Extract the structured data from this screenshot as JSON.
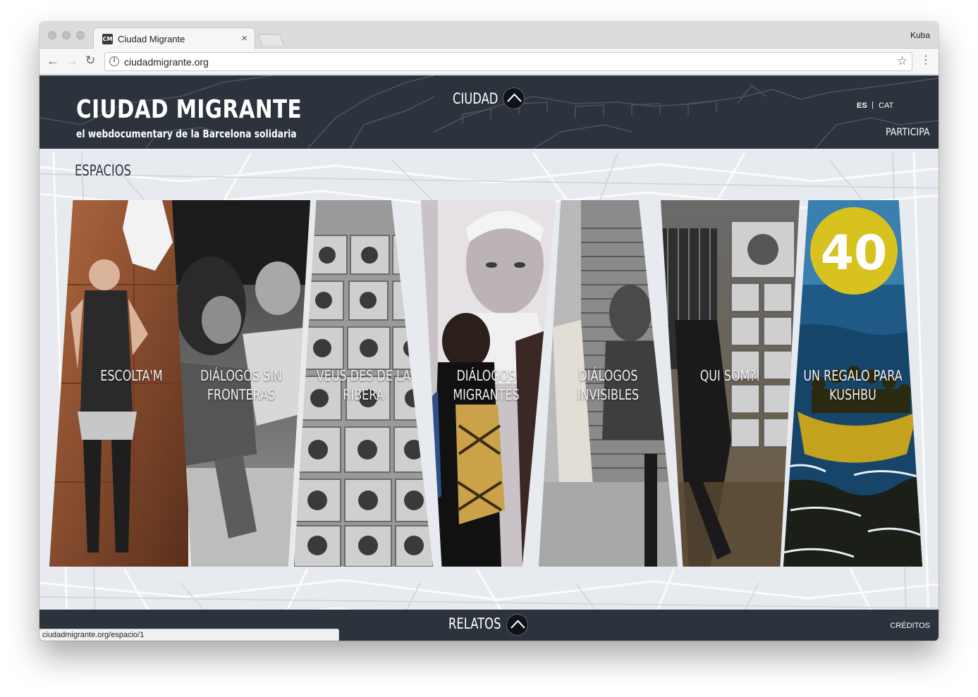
{
  "browser": {
    "tab_title": "Ciudad Migrante",
    "tab_favicon": "CM",
    "profile_name": "Kuba",
    "url": "ciudadmigrante.org",
    "status_url": "ciudadmigrante.org/espacio/1"
  },
  "header": {
    "title": "CIUDAD MIGRANTE",
    "subtitle": "el webdocumentary de la Barcelona solidaria",
    "nav_label": "CIUDAD",
    "lang_es": "ES",
    "lang_separator": "|",
    "lang_cat": "CAT",
    "participa": "PARTICIPA"
  },
  "section": {
    "title": "ESPACIOS"
  },
  "panels": [
    {
      "label": "ESCOLTA'M",
      "icon": "photo-woman-wall"
    },
    {
      "label": "DIÁLOGOS SIN\nFRONTERAS",
      "icon": "photo-workshop"
    },
    {
      "label": "VEUS DES DE LA\nRIBERA",
      "icon": "photo-portrait-grid"
    },
    {
      "label": "DIÁLOGOS\nMIGRANTES",
      "icon": "photo-mural-man"
    },
    {
      "label": "DIÁLOGOS\nINVISIBLES",
      "icon": "photo-street-shutter"
    },
    {
      "label": "QUI SOM?!",
      "icon": "photo-street-walker"
    },
    {
      "label": "UN REGALO PARA\nKUSHBU",
      "icon": "illustration-boat-40"
    }
  ],
  "footer": {
    "nav_label": "RELATOS",
    "creditos": "CRÉDITOS"
  },
  "colors": {
    "header_bg": "#2c333d",
    "page_bg": "#e7eaee"
  }
}
